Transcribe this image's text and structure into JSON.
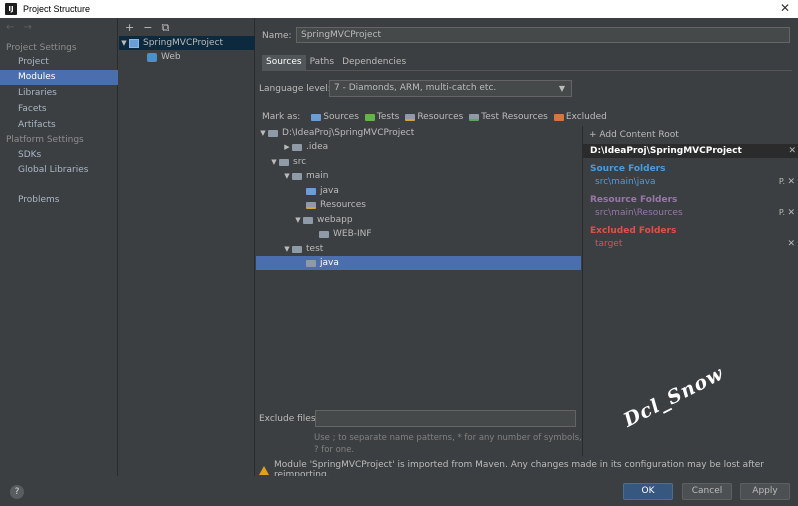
{
  "window": {
    "title": "Project Structure",
    "app_icon": "IJ",
    "close_glyph": "✕"
  },
  "left_panel": {
    "nav_arrows": "← →",
    "project_settings_header": "Project Settings",
    "project_items": [
      "Project",
      "Modules",
      "Libraries",
      "Facets",
      "Artifacts"
    ],
    "platform_settings_header": "Platform Settings",
    "platform_items": [
      "SDKs",
      "Global Libraries"
    ],
    "problems": "Problems",
    "selected": "Modules"
  },
  "module_panel": {
    "toolbar": [
      "+",
      "−",
      "⧉"
    ],
    "module_name": "SpringMVCProject",
    "facet_name": "Web"
  },
  "main": {
    "name_label": "Name:",
    "name_value": "SpringMVCProject",
    "tabs": [
      "Sources",
      "Paths",
      "Dependencies"
    ],
    "active_tab": "Sources",
    "language_label": "Language level:",
    "language_value": "7 - Diamonds, ARM, multi-catch etc.",
    "mark_as_label": "Mark as:",
    "mark_as": [
      "Sources",
      "Tests",
      "Resources",
      "Test Resources",
      "Excluded"
    ],
    "tree": {
      "root": "D:\\IdeaProj\\SpringMVCProject",
      "idea": ".idea",
      "src": "src",
      "main": "main",
      "java_main": "java",
      "resources": "Resources",
      "webapp": "webapp",
      "webinf": "WEB-INF",
      "test": "test",
      "java_test": "java"
    },
    "exclude_label": "Exclude files:",
    "exclude_value": "",
    "exclude_hint": "Use ; to separate name patterns, * for any number of symbols, ? for one.",
    "warning": "Module 'SpringMVCProject' is imported from Maven. Any changes made in its configuration may be lost after reimporting."
  },
  "roots": {
    "add_label": "+ Add Content Root",
    "path": "D:\\IdeaProj\\SpringMVCProject",
    "source_title": "Source Folders",
    "source_item": "src\\main\\java",
    "resource_title": "Resource Folders",
    "resource_item": "src\\main\\Resources",
    "excluded_title": "Excluded Folders",
    "excluded_item": "target",
    "colors": {
      "source": "#4a9be0",
      "resource": "#9876aa",
      "excluded": "#e0504a"
    }
  },
  "watermark": "Dcl_Snow",
  "buttons": {
    "help": "?",
    "ok": "OK",
    "cancel": "Cancel",
    "apply": "Apply"
  }
}
